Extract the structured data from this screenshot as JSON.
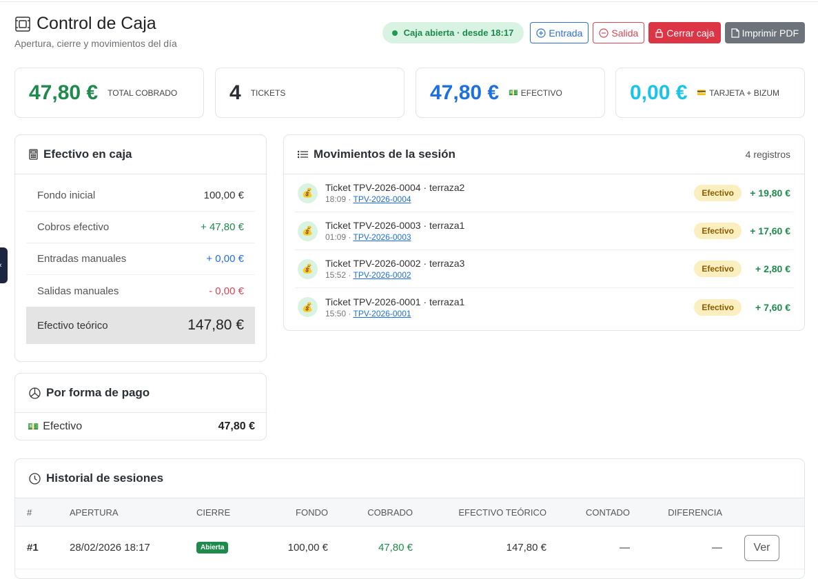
{
  "header": {
    "title": "Control de Caja",
    "subtitle": "Apertura, cierre y movimientos del día",
    "status": "Caja abierta · desde 18:17",
    "btn_in": "Entrada",
    "btn_out": "Salida",
    "btn_close": "Cerrar caja",
    "btn_pdf": "Imprimir PDF"
  },
  "stats": [
    {
      "value": "47,80 €",
      "label": "TOTAL COBRADO",
      "emoji": ""
    },
    {
      "value": "4",
      "label": "TICKETS",
      "emoji": ""
    },
    {
      "value": "47,80 €",
      "label": "EFECTIVO",
      "emoji": "💵"
    },
    {
      "value": "0,00 €",
      "label": "TARJETA + BIZUM",
      "emoji": "💳"
    }
  ],
  "cash": {
    "title": "Efectivo en caja",
    "rows": [
      {
        "label": "Fondo inicial",
        "value": "100,00 €"
      },
      {
        "label": "Cobros efectivo",
        "value": "+ 47,80 €"
      },
      {
        "label": "Entradas manuales",
        "value": "+ 0,00 €"
      },
      {
        "label": "Salidas manuales",
        "value": "- 0,00 €"
      }
    ],
    "total_label": "Efectivo teórico",
    "total_value": "147,80 €"
  },
  "payments": {
    "title": "Por forma de pago",
    "rows": [
      {
        "emoji": "💵",
        "label": "Efectivo",
        "value": "47,80 €"
      }
    ]
  },
  "movements": {
    "title": "Movimientos de la sesión",
    "count": "4 registros",
    "items": [
      {
        "icon": "💰",
        "title": "Ticket TPV-2026-0004 · terraza2",
        "time": "18:09 · ",
        "ref": "TPV-2026-0004",
        "badge": "Efectivo",
        "amount": "+ 19,80 €"
      },
      {
        "icon": "💰",
        "title": "Ticket TPV-2026-0003 · terraza1",
        "time": "01:09 · ",
        "ref": "TPV-2026-0003",
        "badge": "Efectivo",
        "amount": "+ 17,60 €"
      },
      {
        "icon": "💰",
        "title": "Ticket TPV-2026-0002 · terraza3",
        "time": "15:52 · ",
        "ref": "TPV-2026-0002",
        "badge": "Efectivo",
        "amount": "+ 2,80 €"
      },
      {
        "icon": "💰",
        "title": "Ticket TPV-2026-0001 · terraza1",
        "time": "15:50 · ",
        "ref": "TPV-2026-0001",
        "badge": "Efectivo",
        "amount": "+ 7,60 €"
      }
    ]
  },
  "history": {
    "title": "Historial de sesiones",
    "columns": [
      "#",
      "APERTURA",
      "CIERRE",
      "FONDO",
      "COBRADO",
      "EFECTIVO TEÓRICO",
      "CONTADO",
      "DIFERENCIA"
    ],
    "rows": [
      {
        "num": "#1",
        "open": "28/02/2026 18:17",
        "close": "Abierta",
        "fund": "100,00 €",
        "collected": "47,80 €",
        "theoretical": "147,80 €",
        "counted": "—",
        "difference": "—",
        "action": "Ver"
      }
    ]
  },
  "colors": {
    "green": "#1e8a4c",
    "blue": "#1e6fe0",
    "cyan": "#19c4ec",
    "red": "#dc3545",
    "gray": "#6c737a"
  }
}
